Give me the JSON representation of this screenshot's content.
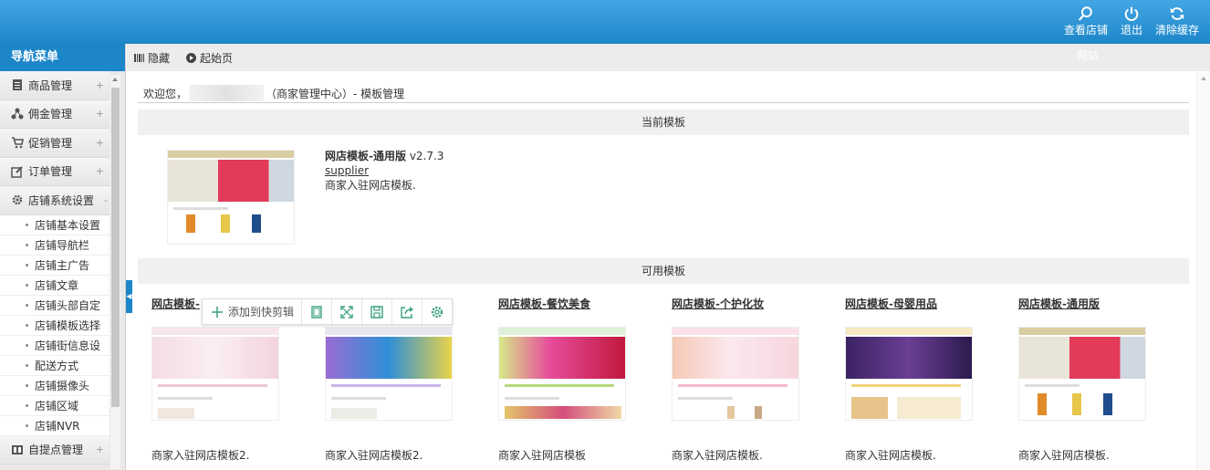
{
  "topbar": {
    "actions": [
      {
        "label": "查看店铺",
        "icon": "search-icon"
      },
      {
        "label": "退出",
        "icon": "power-icon"
      },
      {
        "label": "清除缓存",
        "icon": "refresh-icon"
      }
    ],
    "sub_label": "网站"
  },
  "sidebar": {
    "title": "导航菜单",
    "groups": [
      {
        "label": "商品管理",
        "icon": "document-icon",
        "toggle": "+"
      },
      {
        "label": "佣金管理",
        "icon": "share-icon",
        "toggle": "+"
      },
      {
        "label": "促销管理",
        "icon": "cart-icon",
        "toggle": "+"
      },
      {
        "label": "订单管理",
        "icon": "edit-icon",
        "toggle": "+"
      },
      {
        "label": "店铺系统设置",
        "icon": "gear-icon",
        "toggle": "-"
      }
    ],
    "subitems": [
      "店铺基本设置",
      "店铺导航栏",
      "店铺主广告",
      "店铺文章",
      "店铺头部自定",
      "店铺模板选择",
      "店铺街信息设",
      "配送方式",
      "店铺摄像头",
      "店铺区域",
      "店铺NVR"
    ],
    "last_group": {
      "label": "自提点管理",
      "icon": "table-icon",
      "toggle": "+"
    }
  },
  "content_head": {
    "hide_label": "隐藏",
    "home_label": "起始页"
  },
  "welcome": {
    "prefix": "欢迎您，",
    "suffix": "（商家管理中心）- 模板管理"
  },
  "current": {
    "section_title": "当前模板",
    "name": "网店模板-通用版",
    "version": "v2.7.3",
    "author": "supplier",
    "desc": "商家入驻网店模板."
  },
  "available": {
    "section_title": "可用模板",
    "templates": [
      {
        "name": "网店模板-",
        "desc": "商家入驻网店模板2.",
        "theme": "fashion"
      },
      {
        "name": "",
        "desc": "商家入驻网店模板2.",
        "theme": "fashion2"
      },
      {
        "name": "网店模板-餐饮美食",
        "desc": "商家入驻网店模板",
        "theme": "food"
      },
      {
        "name": "网店模板-个护化妆",
        "desc": "商家入驻网店模板.",
        "theme": "beauty"
      },
      {
        "name": "网店模板-母婴用品",
        "desc": "商家入驻网店模板.",
        "theme": "baby"
      },
      {
        "name": "网店模板-通用版",
        "desc": "商家入驻网店模板.",
        "theme": "general"
      }
    ]
  },
  "float_toolbar": {
    "add_label": "添加到快剪辑"
  },
  "colors": {
    "primary": "#1d86c9",
    "topbar_top": "#43a6e4"
  }
}
